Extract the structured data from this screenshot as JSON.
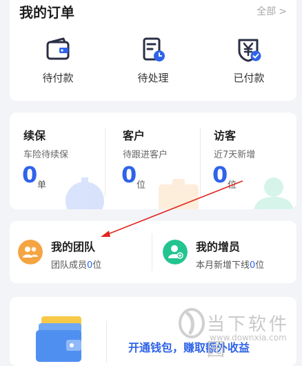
{
  "orders": {
    "title": "我的订单",
    "all_label": "全部",
    "items": [
      {
        "label": "待付款",
        "icon": "wallet-icon"
      },
      {
        "label": "待处理",
        "icon": "document-clock-icon"
      },
      {
        "label": "已付款",
        "icon": "yen-shield-check-icon"
      }
    ]
  },
  "stats": [
    {
      "title": "续保",
      "subtitle": "车险待续保",
      "value": "0",
      "unit": "单"
    },
    {
      "title": "客户",
      "subtitle": "待跟进客户",
      "value": "0",
      "unit": "位"
    },
    {
      "title": "访客",
      "subtitle": "近7天新增",
      "value": "0",
      "unit": "位"
    }
  ],
  "team": [
    {
      "title": "我的团队",
      "subtitle_prefix": "团队成员",
      "count": "0",
      "subtitle_suffix": "位",
      "icon": "team-icon"
    },
    {
      "title": "我的增员",
      "subtitle_prefix": "本月新增下线",
      "count": "0",
      "subtitle_suffix": "位",
      "icon": "add-member-icon"
    }
  ],
  "wallet": {
    "promo": "开通钱包，赚取额外收益"
  },
  "watermark": {
    "name": "当下软件园",
    "url": "www.downxia.com"
  },
  "colors": {
    "accent": "#2f63e9",
    "team_orange": "#f5a442",
    "team_green": "#22c48f"
  }
}
